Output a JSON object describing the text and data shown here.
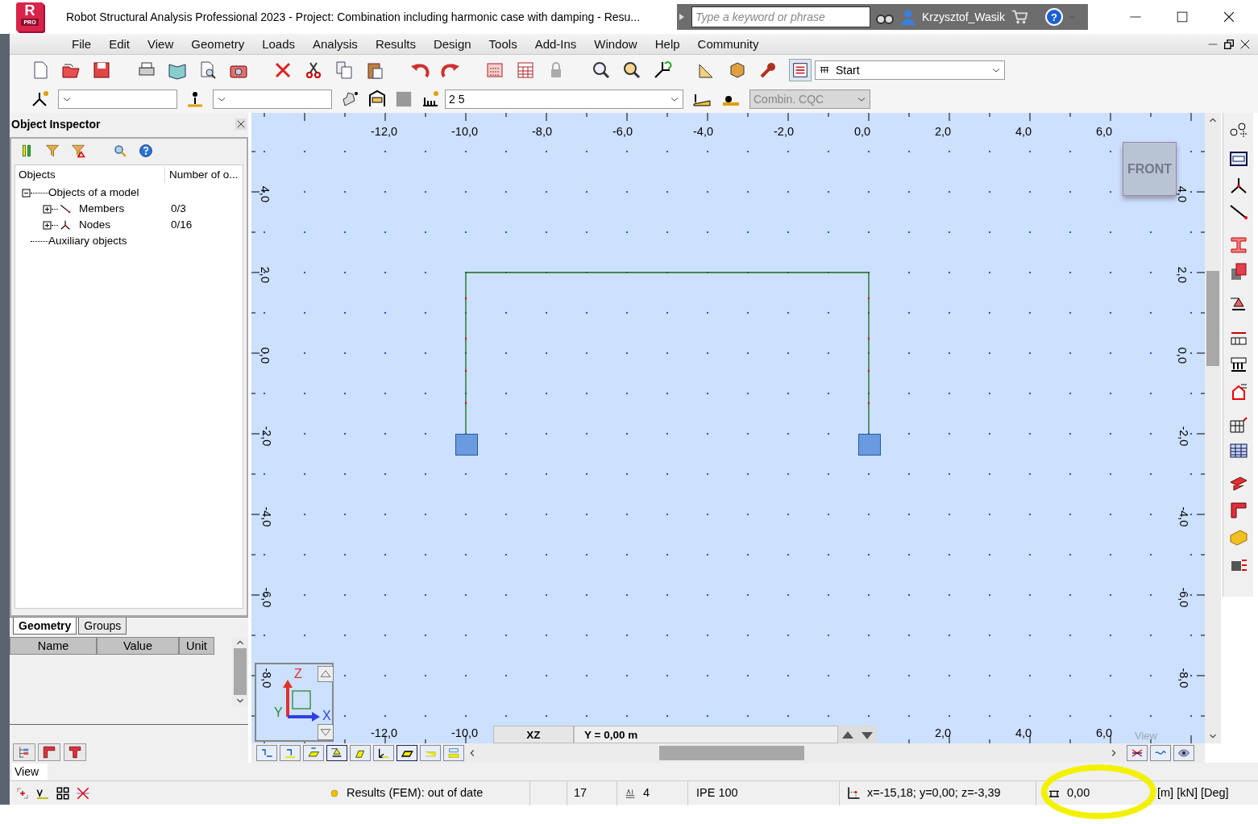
{
  "window": {
    "title": "Robot Structural Analysis Professional 2023 - Project: Combination including harmonic case with damping - Resu...",
    "logo_letter": "R",
    "logo_badge": "PRO"
  },
  "search": {
    "placeholder": "Type a keyword or phrase"
  },
  "user": {
    "name": "Krzysztof_Wasik",
    "help_glyph": "?"
  },
  "menu": [
    "File",
    "Edit",
    "View",
    "Geometry",
    "Loads",
    "Analysis",
    "Results",
    "Design",
    "Tools",
    "Add-Ins",
    "Window",
    "Help",
    "Community"
  ],
  "toolbar": {
    "layout_select": "Start",
    "case_select": "2 5",
    "combination_select": "Combin. CQC",
    "combination_disabled": true
  },
  "object_inspector": {
    "title": "Object Inspector",
    "columns": [
      "Objects",
      "Number of o..."
    ],
    "tree": [
      {
        "label": "Objects of a model",
        "expanded": true,
        "children": [
          {
            "label": "Members",
            "kind": "members",
            "count": "0/3",
            "expanded": false
          },
          {
            "label": "Nodes",
            "kind": "nodes",
            "count": "0/16",
            "expanded": false
          }
        ]
      },
      {
        "label": "Auxiliary objects"
      }
    ]
  },
  "tabs": [
    {
      "label": "Geometry",
      "selected": true
    },
    {
      "label": "Groups",
      "selected": false
    }
  ],
  "properties": {
    "columns": [
      "Name",
      "Value",
      "Unit"
    ]
  },
  "view_field": "View",
  "canvas": {
    "top_axis": [
      "-12,0",
      "-10,0",
      "-8,0",
      "-6,0",
      "-4,0",
      "-2,0",
      "0,0",
      "2,0",
      "4,0",
      "6,0"
    ],
    "bottom_axis": [
      "-12,0",
      "-10,0",
      "2,0",
      "4,0",
      "6,0"
    ],
    "left_axis": [
      "4,0",
      "2,0",
      "0,0",
      "-2,0",
      "-4,0",
      "-6,0",
      "-8,0"
    ],
    "right_axis": [
      "4,0",
      "2,0",
      "0,0",
      "-2,0",
      "-4,0",
      "-6,0",
      "-8,0"
    ],
    "view_cube": "FRONT",
    "plane": "XZ",
    "position": "Y = 0,00 m",
    "view_label": "View",
    "gizmo": {
      "z": "Z",
      "y": "Y",
      "x": "X"
    }
  },
  "status": {
    "indicator": "Results (FEM): out of date",
    "node_count": "17",
    "case": "4",
    "section": "IPE 100",
    "coords": "x=-15,18; y=0,00; z=-3,39",
    "angle": "0,00",
    "units": "[m] [kN] [Deg]"
  }
}
